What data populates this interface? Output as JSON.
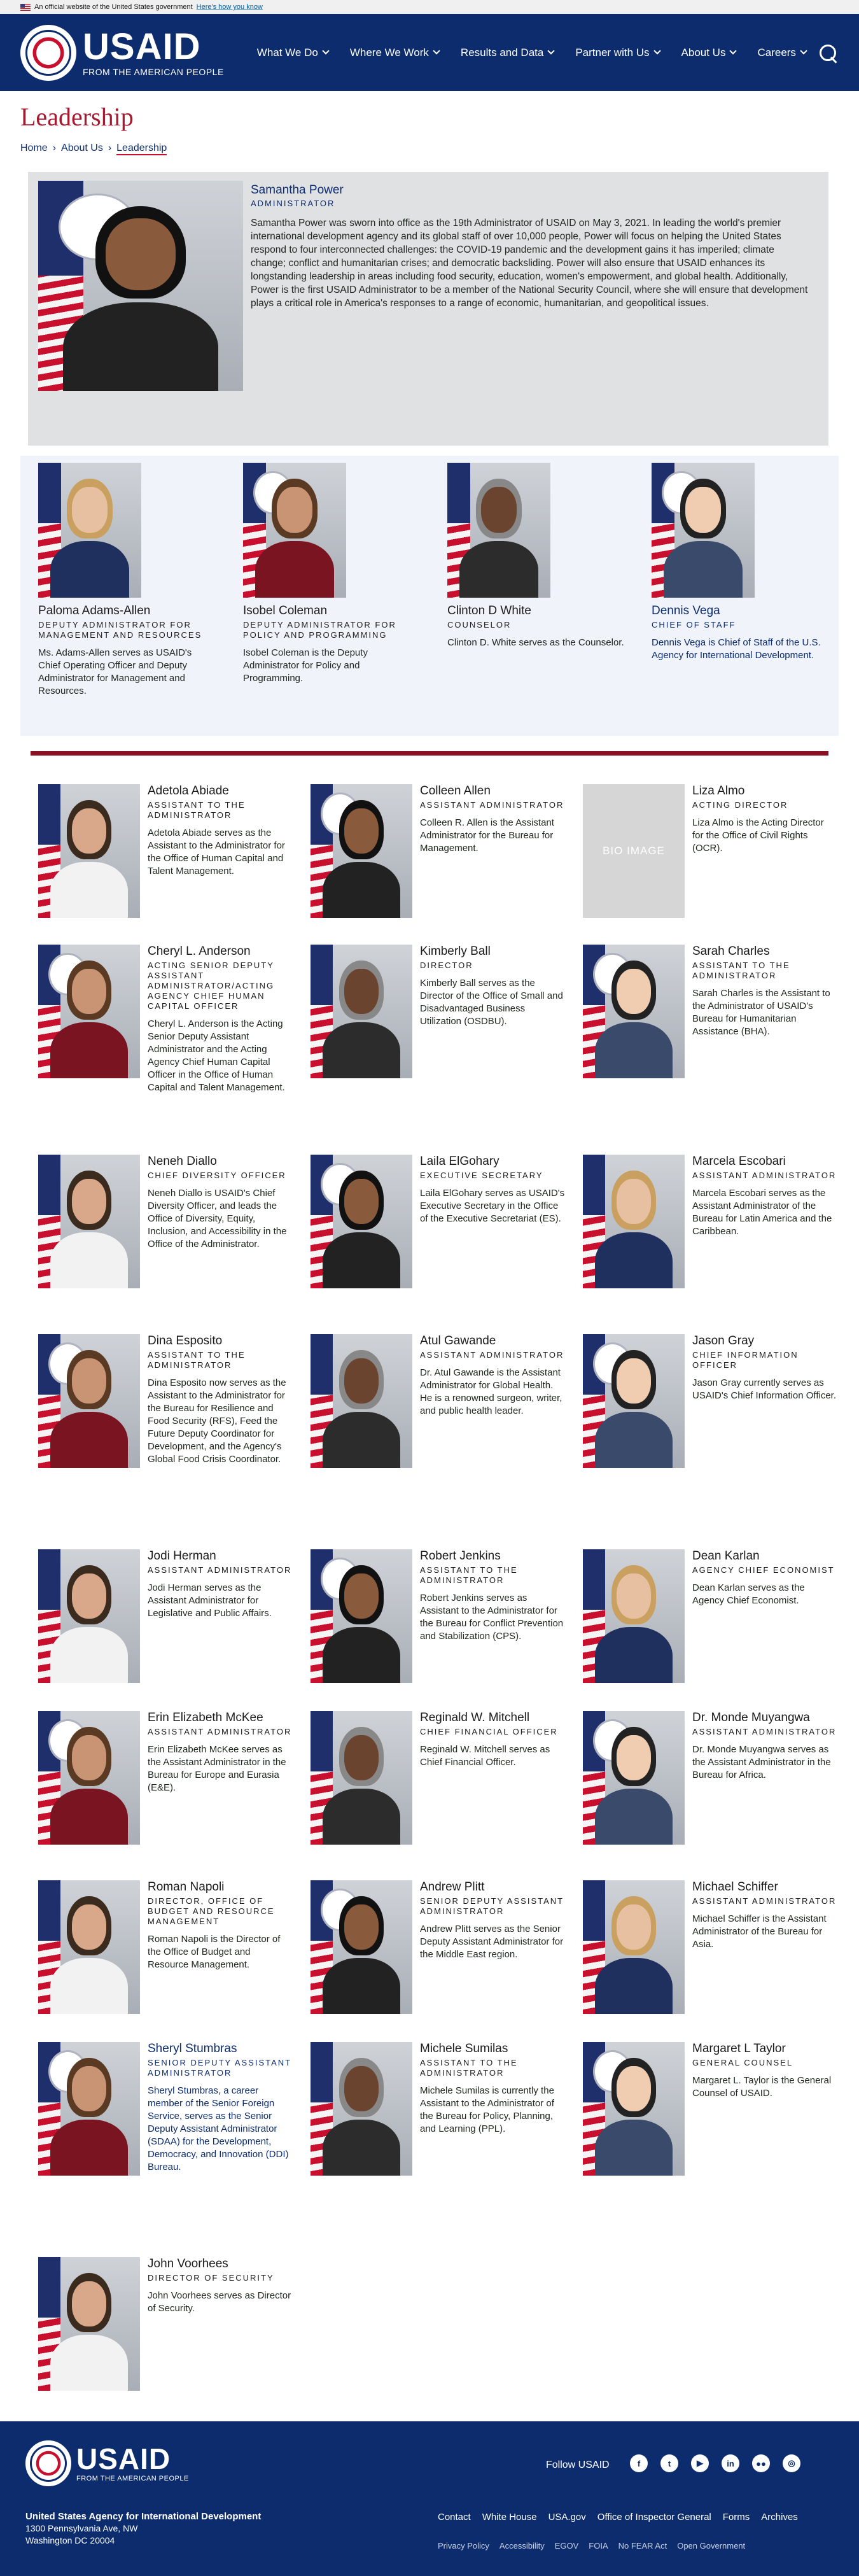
{
  "gov_banner": {
    "text": "An official website of the United States government",
    "link": "Here's how you know"
  },
  "brand": {
    "word": "USAID",
    "tagline": "FROM THE AMERICAN PEOPLE"
  },
  "menu": [
    "What We Do",
    "Where We Work",
    "Results and Data",
    "Partner with Us",
    "About Us",
    "Careers"
  ],
  "page_title": "Leadership",
  "breadcrumb": [
    "Home",
    "About Us",
    "Leadership"
  ],
  "administrator": {
    "name": "Samantha Power",
    "title": "ADMINISTRATOR",
    "bio": "Samantha Power was sworn into office as the 19th Administrator of USAID on May 3, 2021. In leading the world's premier international development agency and its global staff of over 10,000 people, Power will focus on helping the United States respond to four interconnected challenges: the COVID-19 pandemic and the development gains it has imperiled; climate change; conflict and humanitarian crises; and democratic backsliding. Power will also ensure that USAID enhances its longstanding leadership in areas including food security, education, women's empowerment, and global health. Additionally, Power is the first USAID Administrator to be a member of the National Security Council, where she will ensure that development plays a critical role in America's responses to a range of economic, humanitarian, and geopolitical issues."
  },
  "deputies": [
    {
      "name": "Paloma Adams-Allen",
      "title": "Deputy Administrator for Management and Resources",
      "bio": "Ms. Adams-Allen serves as USAID's Chief Operating Officer and Deputy Administrator for Management and Resources."
    },
    {
      "name": "Isobel Coleman",
      "title": "Deputy Administrator for Policy and Programming",
      "bio": "Isobel Coleman is the Deputy Administrator for Policy and Programming."
    },
    {
      "name": "Clinton D White",
      "title": "Counselor",
      "bio": "Clinton D. White serves as the Counselor."
    },
    {
      "name": "Dennis Vega",
      "title": "Chief of Staff",
      "bio": "Dennis Vega is Chief of Staff of the U.S. Agency for International Development."
    }
  ],
  "leaders": [
    {
      "name": "Adetola Abiade",
      "title": "Assistant to the Administrator",
      "bio": "Adetola Abiade serves as the Assistant to the Administrator for the Office of Human Capital and Talent Management."
    },
    {
      "name": "Colleen Allen",
      "title": "Assistant Administrator",
      "bio": "Colleen R. Allen is the Assistant Administrator for the Bureau for Management."
    },
    {
      "name": "Liza Almo",
      "title": "Acting Director",
      "bio": "Liza Almo is the Acting Director for the Office of Civil Rights (OCR).",
      "placeholder": "BIO IMAGE"
    },
    {
      "name": "Cheryl L. Anderson",
      "title": "Acting Senior Deputy Assistant Administrator/Acting Agency Chief Human Capital Officer",
      "bio": "Cheryl L. Anderson is the Acting Senior Deputy Assistant Administrator and the Acting Agency Chief Human Capital Officer in the Office of Human Capital and Talent Management."
    },
    {
      "name": "Kimberly Ball",
      "title": "Director",
      "bio": "Kimberly Ball serves as the Director of the Office of Small and Disadvantaged Business Utilization (OSDBU)."
    },
    {
      "name": "Sarah Charles",
      "title": "Assistant to the Administrator",
      "bio": "Sarah Charles is the Assistant to the Administrator of USAID's Bureau for Humanitarian Assistance (BHA)."
    },
    {
      "name": "Neneh Diallo",
      "title": "Chief Diversity Officer",
      "bio": "Neneh Diallo is USAID's Chief Diversity Officer, and leads the Office of Diversity, Equity, Inclusion, and Accessibility in the Office of the Administrator."
    },
    {
      "name": "Laila ElGohary",
      "title": "Executive Secretary",
      "bio": "Laila ElGohary serves as USAID's Executive Secretary in the Office of the Executive Secretariat (ES)."
    },
    {
      "name": "Marcela Escobari",
      "title": "Assistant Administrator",
      "bio": "Marcela Escobari serves as the Assistant Administrator of the Bureau for Latin America and the Caribbean."
    },
    {
      "name": "Dina Esposito",
      "title": "Assistant to the Administrator",
      "bio": "Dina Esposito now serves as the Assistant to the Administrator for the Bureau for Resilience and Food Security (RFS), Feed the Future Deputy Coordinator for Development, and the Agency's Global Food Crisis Coordinator."
    },
    {
      "name": "Atul Gawande",
      "title": "Assistant Administrator",
      "bio": "Dr. Atul Gawande is the Assistant Administrator for Global Health. He is a renowned surgeon, writer, and public health leader."
    },
    {
      "name": "Jason Gray",
      "title": "Chief Information Officer",
      "bio": "Jason Gray currently serves as USAID's Chief Information Officer."
    },
    {
      "name": "Jodi Herman",
      "title": "Assistant Administrator",
      "bio": "Jodi Herman serves as the Assistant Administrator for Legislative and Public Affairs."
    },
    {
      "name": "Robert Jenkins",
      "title": "Assistant to the Administrator",
      "bio": "Robert Jenkins serves as Assistant to the Administrator for the Bureau for Conflict Prevention and Stabilization (CPS)."
    },
    {
      "name": "Dean Karlan",
      "title": "Agency Chief Economist",
      "bio": "Dean Karlan serves as the Agency Chief Economist."
    },
    {
      "name": "Erin Elizabeth McKee",
      "title": "Assistant Administrator",
      "bio": "Erin Elizabeth McKee serves as the Assistant Administrator in the Bureau for Europe and Eurasia (E&E)."
    },
    {
      "name": "Reginald W. Mitchell",
      "title": "Chief Financial Officer",
      "bio": "Reginald W. Mitchell serves as Chief Financial Officer."
    },
    {
      "name": "Dr. Monde Muyangwa",
      "title": "Assistant Administrator",
      "bio": "Dr. Monde Muyangwa serves as the Assistant Administrator in the Bureau for Africa."
    },
    {
      "name": "Roman Napoli",
      "title": "Director, Office of Budget and Resource Management",
      "bio": "Roman Napoli is the Director of the Office of Budget and Resource Management."
    },
    {
      "name": "Andrew Plitt",
      "title": "Senior Deputy Assistant Administrator",
      "bio": "Andrew Plitt serves as the Senior Deputy Assistant Administrator for the Middle East region."
    },
    {
      "name": "Michael Schiffer",
      "title": "Assistant Administrator",
      "bio": "Michael Schiffer is the Assistant Administrator of the Bureau for Asia."
    },
    {
      "name": "Sheryl Stumbras",
      "title": "Senior Deputy Assistant Administrator",
      "bio": "Sheryl Stumbras, a career member of the Senior Foreign Service, serves as the Senior Deputy Assistant Administrator (SDAA) for the Development, Democracy, and Innovation (DDI) Bureau."
    },
    {
      "name": "Michele Sumilas",
      "title": "Assistant to the Administrator",
      "bio": "Michele Sumilas is currently the Assistant to the Administrator of the Bureau for Policy, Planning, and Learning (PPL)."
    },
    {
      "name": "Margaret L Taylor",
      "title": "General Counsel",
      "bio": "Margaret L. Taylor is the General Counsel of USAID."
    },
    {
      "name": "John Voorhees",
      "title": "Director of Security",
      "bio": "John Voorhees serves as Director of Security."
    }
  ],
  "footer": {
    "follow": "Follow USAID",
    "social": [
      "f",
      "t",
      "▶",
      "in",
      "●●",
      "◎"
    ],
    "social_icons": [
      "facebook-icon",
      "twitter-icon",
      "youtube-icon",
      "linkedin-icon",
      "flickr-icon",
      "instagram-icon"
    ],
    "org": "United States Agency for International Development",
    "addr1": "1300 Pennsylvania Ave, NW",
    "addr2": "Washington DC 20004",
    "links": [
      "Contact",
      "White House",
      "USA.gov",
      "Office of Inspector General",
      "Forms",
      "Archives"
    ],
    "policy": [
      "Privacy Policy",
      "Accessibility",
      "EGOV",
      "FOIA",
      "No FEAR Act",
      "Open Government"
    ]
  },
  "colors": {
    "navy": "#0c2c6e",
    "crimson": "#a7192e",
    "rule": "#8b1024"
  }
}
